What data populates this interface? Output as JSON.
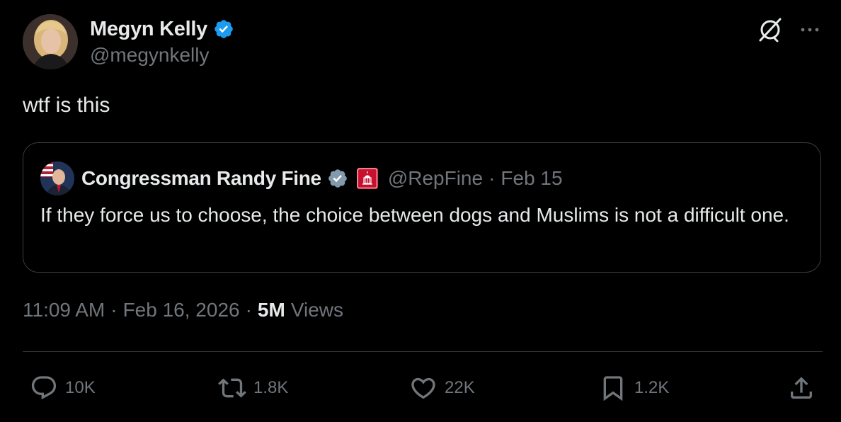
{
  "author": {
    "name": "Megyn Kelly",
    "handle": "@megynkelly",
    "verified": true
  },
  "tweet": {
    "text": "wtf is this"
  },
  "quoted_tweet": {
    "author_name": "Congressman Randy Fine",
    "handle": "@RepFine",
    "separator": "·",
    "date": "Feb 15",
    "verified": "gray",
    "text": "If they force us to choose, the choice between dogs and Muslims is not a difficult one."
  },
  "meta": {
    "time": "11:09 AM",
    "date": "Feb 16, 2026",
    "separator": "·",
    "views_count": "5M",
    "views_label": "Views"
  },
  "actions": {
    "replies": "10K",
    "reposts": "1.8K",
    "likes": "22K",
    "bookmarks": "1.2K"
  },
  "icons": {
    "verified_blue": "verified-badge-icon",
    "verified_gray": "government-verified-badge-icon",
    "grok": "grok-icon",
    "more": "more-icon",
    "reply": "reply-icon",
    "repost": "repost-icon",
    "like": "like-icon",
    "bookmark": "bookmark-icon",
    "share": "share-icon"
  },
  "colors": {
    "background": "#000000",
    "text_primary": "#e7e9ea",
    "text_secondary": "#71767b",
    "verified_blue": "#1d9bf0",
    "verified_gray": "#829aab",
    "affiliation_red": "#c8102e",
    "border": "#2f3336"
  }
}
